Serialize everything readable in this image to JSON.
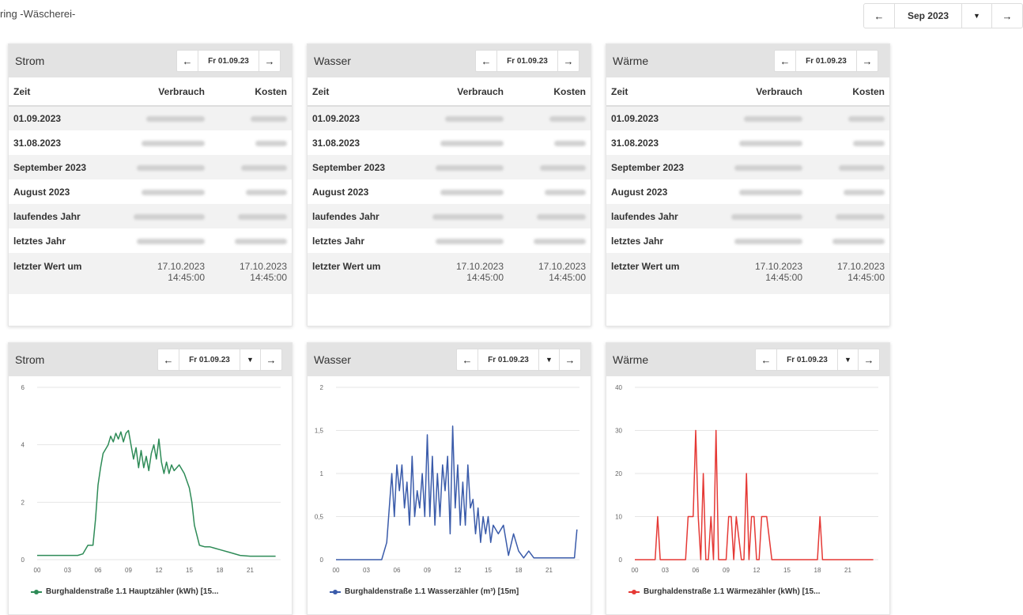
{
  "page": {
    "title": "ring -Wäscherei-"
  },
  "top_nav": {
    "period": "Sep 2023",
    "prev_icon": "arrow-left-icon",
    "next_icon": "arrow-right-icon",
    "dropdown_icon": "caret-down-icon"
  },
  "table_headers": {
    "time": "Zeit",
    "consumption": "Verbrauch",
    "cost": "Kosten"
  },
  "table_rows": [
    "01.09.2023",
    "31.08.2023",
    "September 2023",
    "August 2023",
    "laufendes Jahr",
    "letztes Jahr"
  ],
  "last_value": {
    "label": "letzter Wert um",
    "date": "17.10.2023",
    "time": "14:45:00"
  },
  "tables": [
    {
      "title": "Strom",
      "date": "Fr 01.09.23"
    },
    {
      "title": "Wasser",
      "date": "Fr 01.09.23"
    },
    {
      "title": "Wärme",
      "date": "Fr 01.09.23"
    }
  ],
  "charts": [
    {
      "title": "Strom",
      "date": "Fr 01.09.23",
      "legend": "Burghaldenstraße 1.1 Hauptzähler (kWh) [15...",
      "color": "#2e8b57"
    },
    {
      "title": "Wasser",
      "date": "Fr 01.09.23",
      "legend": "Burghaldenstraße 1.1 Wasserzähler (m³) [15m]",
      "color": "#3a5baa"
    },
    {
      "title": "Wärme",
      "date": "Fr 01.09.23",
      "legend": "Burghaldenstraße 1.1 Wärmezähler (kWh) [15...",
      "color": "#e53935"
    }
  ],
  "chart_data": [
    {
      "type": "line",
      "x_ticks": [
        "00",
        "03",
        "06",
        "09",
        "12",
        "15",
        "18",
        "21"
      ],
      "y_ticks": [
        "0",
        "2",
        "4",
        "6"
      ],
      "ylim": [
        0,
        6
      ],
      "xlim": [
        0,
        24
      ],
      "series": [
        {
          "name": "Burghaldenstraße 1.1 Hauptzähler (kWh) [15...",
          "x": [
            0,
            2,
            4,
            4.5,
            5,
            5.5,
            5.75,
            6,
            6.25,
            6.5,
            7,
            7.25,
            7.5,
            7.75,
            8,
            8.25,
            8.5,
            8.75,
            9,
            9.25,
            9.5,
            9.75,
            10,
            10.25,
            10.5,
            10.75,
            11,
            11.25,
            11.5,
            11.75,
            12,
            12.25,
            12.5,
            12.75,
            13,
            13.25,
            13.5,
            14,
            14.5,
            15,
            15.25,
            15.5,
            16,
            16.5,
            17,
            17.5,
            18,
            19,
            20,
            21,
            22,
            23.5
          ],
          "y": [
            0.15,
            0.15,
            0.15,
            0.2,
            0.5,
            0.5,
            1.4,
            2.6,
            3.2,
            3.7,
            4.0,
            4.3,
            4.1,
            4.4,
            4.2,
            4.45,
            4.1,
            4.4,
            4.5,
            4.0,
            3.5,
            3.9,
            3.2,
            3.8,
            3.2,
            3.6,
            3.1,
            3.7,
            4.0,
            3.5,
            4.2,
            3.4,
            3.0,
            3.4,
            3.0,
            3.3,
            3.1,
            3.3,
            3.0,
            2.5,
            2.0,
            1.2,
            0.5,
            0.45,
            0.45,
            0.4,
            0.35,
            0.25,
            0.15,
            0.12,
            0.12,
            0.12
          ]
        }
      ]
    },
    {
      "type": "line",
      "x_ticks": [
        "00",
        "03",
        "06",
        "09",
        "12",
        "15",
        "18",
        "21"
      ],
      "y_ticks": [
        "0",
        "0,5",
        "1",
        "1,5",
        "2"
      ],
      "ylim": [
        0,
        2
      ],
      "xlim": [
        0,
        24
      ],
      "series": [
        {
          "name": "Burghaldenstraße 1.1 Wasserzähler (m³) [15m]",
          "x": [
            0,
            3,
            4.5,
            5,
            5.25,
            5.5,
            5.75,
            6,
            6.25,
            6.5,
            6.75,
            7,
            7.25,
            7.5,
            7.75,
            8,
            8.25,
            8.5,
            8.75,
            9,
            9.25,
            9.5,
            9.75,
            10,
            10.25,
            10.5,
            10.75,
            11,
            11.25,
            11.5,
            11.75,
            12,
            12.25,
            12.5,
            12.75,
            13,
            13.25,
            13.5,
            13.75,
            14,
            14.25,
            14.5,
            14.75,
            15,
            15.25,
            15.5,
            16,
            16.5,
            17,
            17.5,
            18,
            18.5,
            19,
            19.5,
            20,
            21,
            22,
            23,
            23.5,
            23.75
          ],
          "y": [
            0,
            0,
            0,
            0.2,
            0.6,
            1.0,
            0.5,
            1.1,
            0.8,
            1.1,
            0.6,
            0.9,
            0.4,
            1.2,
            0.5,
            0.8,
            0.6,
            1.0,
            0.5,
            1.45,
            0.5,
            1.2,
            0.4,
            1.0,
            0.5,
            1.1,
            0.8,
            1.2,
            0.3,
            1.55,
            0.6,
            1.1,
            0.4,
            0.9,
            0.4,
            1.1,
            0.6,
            0.7,
            0.3,
            0.6,
            0.2,
            0.5,
            0.3,
            0.5,
            0.2,
            0.4,
            0.3,
            0.4,
            0.05,
            0.3,
            0.1,
            0.02,
            0.1,
            0.02,
            0.02,
            0.02,
            0.02,
            0.02,
            0.02,
            0.35
          ]
        }
      ]
    },
    {
      "type": "line",
      "x_ticks": [
        "00",
        "03",
        "06",
        "09",
        "12",
        "15",
        "18",
        "21"
      ],
      "y_ticks": [
        "0",
        "10",
        "20",
        "30",
        "40"
      ],
      "ylim": [
        0,
        40
      ],
      "xlim": [
        0,
        24
      ],
      "series": [
        {
          "name": "Burghaldenstraße 1.1 Wärmezähler (kWh) [15...",
          "x": [
            0,
            2,
            2.25,
            2.5,
            5,
            5.25,
            5.75,
            6,
            6.25,
            6.5,
            6.75,
            7,
            7.25,
            7.5,
            7.75,
            8,
            8.25,
            8.5,
            8.75,
            9,
            9.25,
            9.5,
            9.75,
            10,
            10.5,
            10.75,
            11,
            11.25,
            11.5,
            11.75,
            12,
            12.25,
            12.5,
            12.75,
            13,
            13.5,
            13.75,
            18,
            18.25,
            18.5,
            18.75,
            23.5
          ],
          "y": [
            0,
            0,
            10,
            0,
            0,
            10,
            10,
            30,
            10,
            0,
            20,
            0,
            0,
            10,
            0,
            30,
            0,
            0,
            0,
            0,
            10,
            10,
            0,
            10,
            0,
            0,
            20,
            0,
            10,
            10,
            0,
            0,
            10,
            10,
            10,
            0,
            0,
            0,
            10,
            0,
            0,
            0
          ]
        }
      ]
    }
  ]
}
